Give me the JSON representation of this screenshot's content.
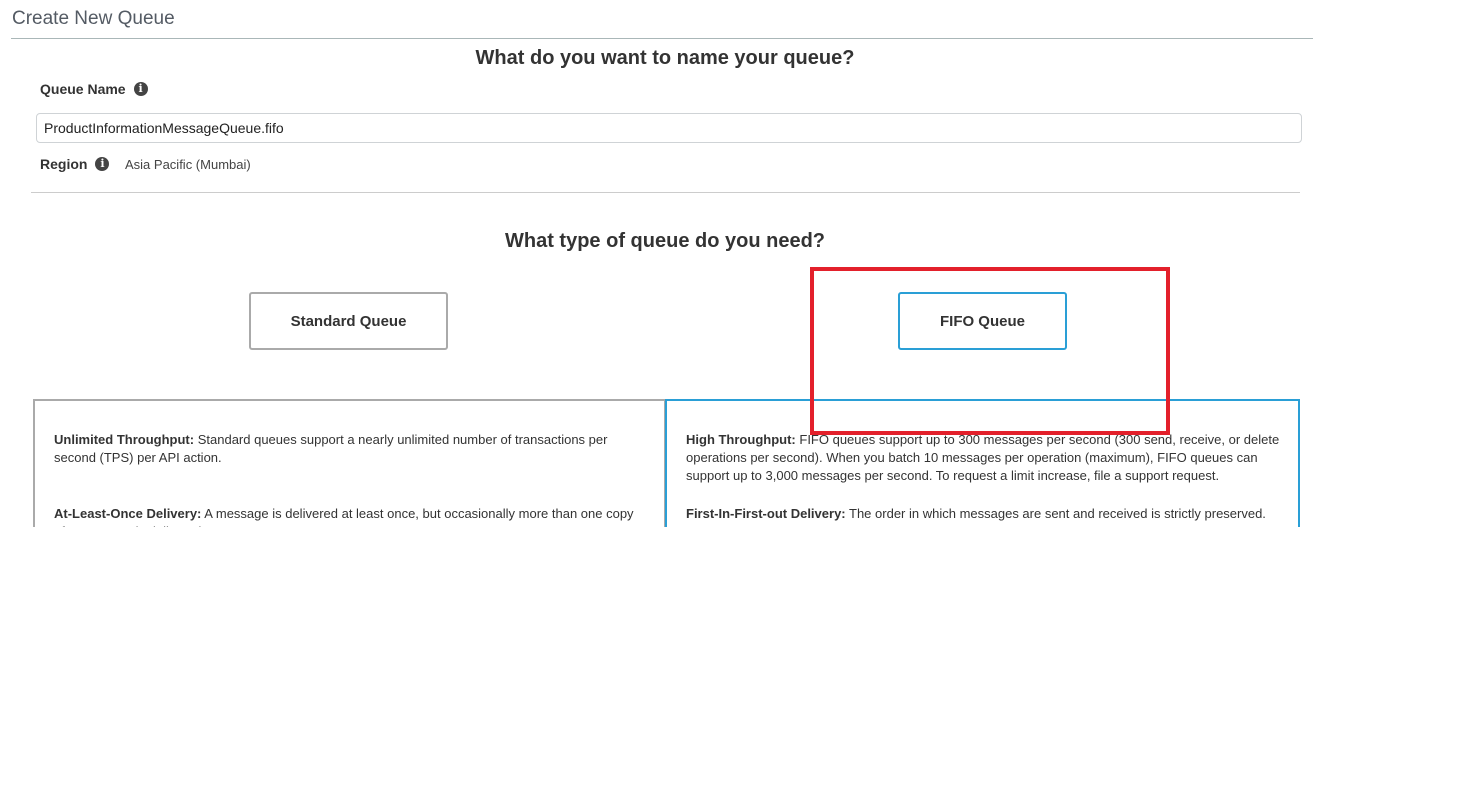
{
  "page": {
    "title": "Create New Queue"
  },
  "name_section": {
    "heading": "What do you want to name your queue?",
    "queue_name_label": "Queue Name",
    "queue_name_value": "ProductInformationMessageQueue.fifo",
    "region_label": "Region",
    "region_value": "Asia Pacific (Mumbai)"
  },
  "type_section": {
    "heading": "What type of queue do you need?",
    "options": [
      {
        "label": "Standard Queue",
        "selected": false,
        "features": [
          {
            "title": "Unlimited Throughput:",
            "text": "Standard queues support a nearly unlimited number of transactions per second (TPS) per API action."
          },
          {
            "title": "At-Least-Once Delivery:",
            "text": "A message is delivered at least once, but occasionally more than one copy of a message is delivered."
          }
        ]
      },
      {
        "label": "FIFO Queue",
        "selected": true,
        "features": [
          {
            "title": "High Throughput:",
            "text": "FIFO queues support up to 300 messages per second (300 send, receive, or delete operations per second). When you batch 10 messages per operation (maximum), FIFO queues can support up to 3,000 messages per second. To request a limit increase, file a support request."
          },
          {
            "title": "First-In-First-out Delivery:",
            "text": "The order in which messages are sent and received is strictly preserved."
          }
        ]
      }
    ]
  },
  "colors": {
    "selected_border": "#2a9fd6",
    "unselected_border": "#aaaaaa",
    "highlight_annotation": "#e3202b"
  },
  "icons": {
    "info": "info-circle-icon"
  }
}
